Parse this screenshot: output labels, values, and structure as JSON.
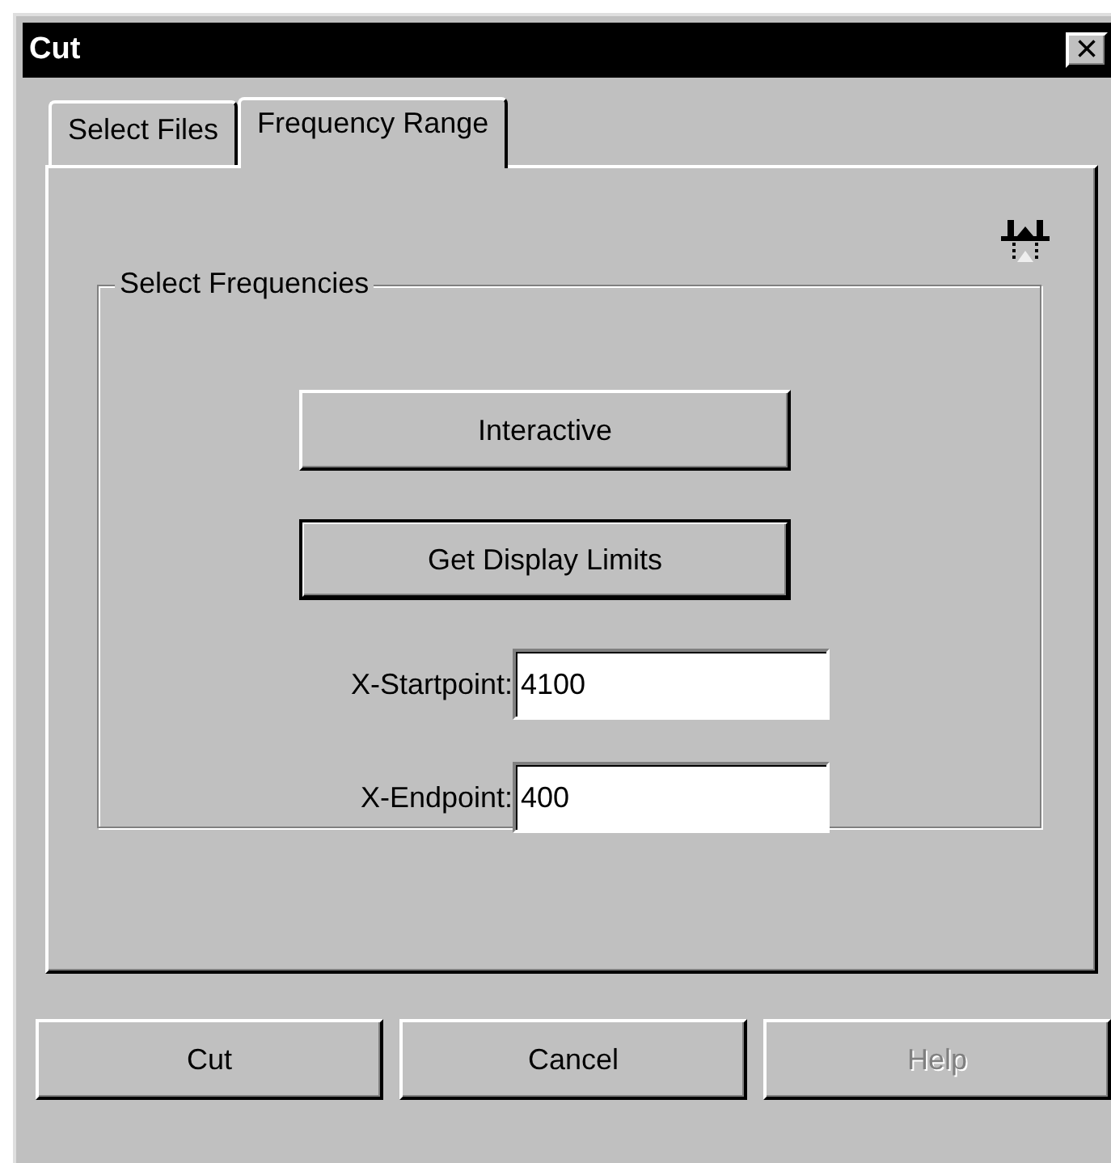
{
  "window": {
    "title": "Cut",
    "close": "×"
  },
  "tabs": [
    {
      "label": "Select Files",
      "selected": false
    },
    {
      "label": "Frequency Range",
      "selected": true
    }
  ],
  "group": {
    "title": "Select Frequencies",
    "buttons": [
      {
        "label": "Interactive",
        "default": false
      },
      {
        "label": "Get Display Limits",
        "default": true
      }
    ],
    "fields": [
      {
        "label": "X-Startpoint:",
        "value": "4100"
      },
      {
        "label": "X-Endpoint:",
        "value": "400"
      }
    ]
  },
  "buttons": [
    {
      "label": "Cut",
      "disabled": false
    },
    {
      "label": "Cancel",
      "disabled": false
    },
    {
      "label": "Help",
      "disabled": true
    }
  ]
}
